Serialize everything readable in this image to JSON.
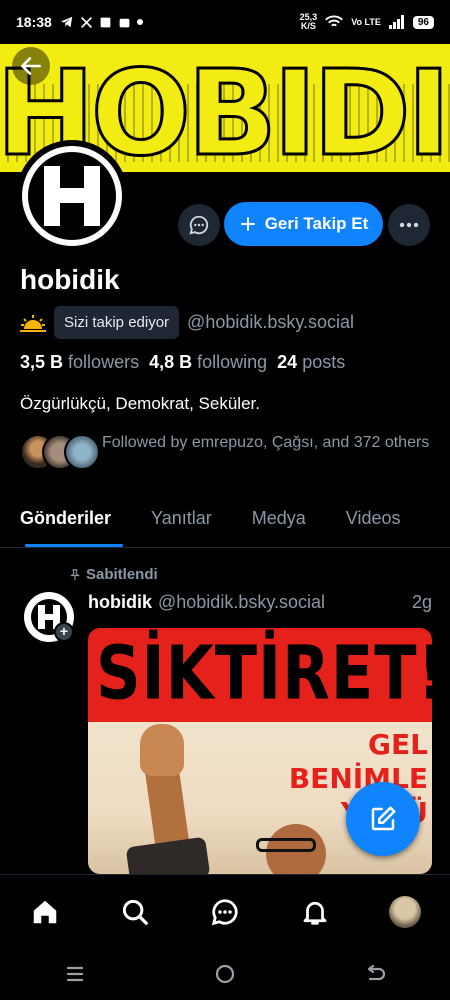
{
  "status_bar": {
    "time": "18:38",
    "speed_value": "25,3",
    "speed_unit": "K/S",
    "network": "Vo LTE",
    "battery": "96"
  },
  "banner": {
    "text": "HOBIDIK",
    "bg_color": "#f2ec13"
  },
  "profile": {
    "display_name": "hobidik",
    "follows_you": "Sizi takip ediyor",
    "handle": "@hobidik.bsky.social",
    "followers_count": "3,5 B",
    "followers_label": "followers",
    "following_count": "4,8 B",
    "following_label": "following",
    "posts_count": "24",
    "posts_label": "posts",
    "bio": "Özgürlükçü, Demokrat, Seküler.",
    "followed_by": "Followed by emrepuzo, Çağsı, and 372 others"
  },
  "actions": {
    "follow_back": "Geri Takip Et"
  },
  "tabs": [
    {
      "label": "Gönderiler",
      "active": true
    },
    {
      "label": "Yanıtlar",
      "active": false
    },
    {
      "label": "Medya",
      "active": false
    },
    {
      "label": "Videos",
      "active": false
    }
  ],
  "pinned_post": {
    "pinned_label": "Sabitlendi",
    "author": "hobidik",
    "handle": "@hobidik.bsky.social",
    "time": "2g",
    "image_title": "SİKTİRET!",
    "image_words": [
      "GEL",
      "BENİMLE",
      "YÜRÜ"
    ]
  },
  "colors": {
    "accent": "#1083fe",
    "background": "#000000",
    "muted": "#8b98a5"
  }
}
